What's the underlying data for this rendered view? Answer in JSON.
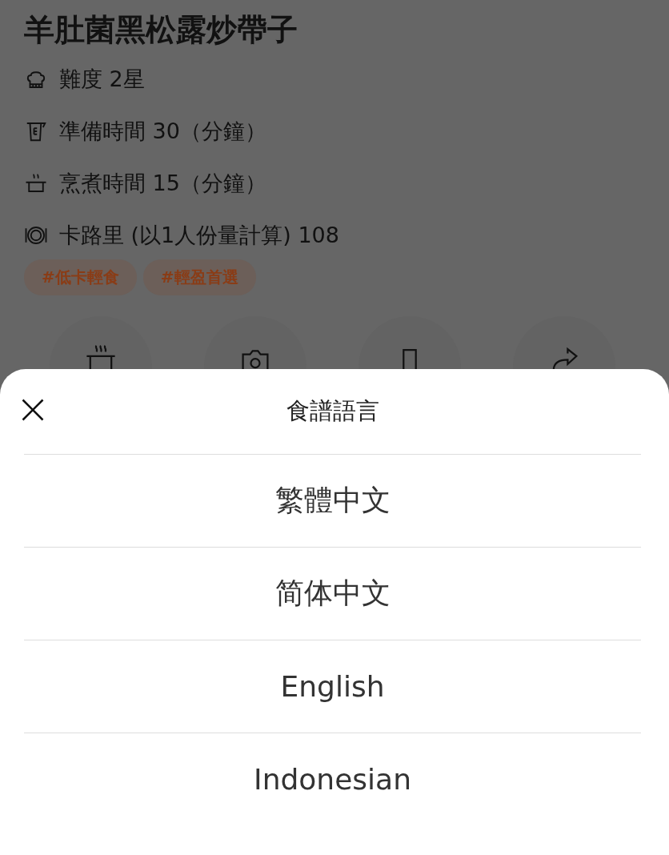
{
  "recipe": {
    "title": "羊肚菌黑松露炒帶子",
    "meta": [
      {
        "kind": "difficulty",
        "text": "難度 2星"
      },
      {
        "kind": "prep",
        "text": "準備時間 30（分鐘）"
      },
      {
        "kind": "cook",
        "text": "烹煮時間 15（分鐘）"
      },
      {
        "kind": "calories",
        "text": "卡路里 (以1人份量計算) 108"
      }
    ],
    "tags": [
      "#低卡輕食",
      "#輕盈首選"
    ],
    "actions": [
      {
        "kind": "cook"
      },
      {
        "kind": "camera"
      },
      {
        "kind": "bookmark"
      },
      {
        "kind": "share"
      }
    ]
  },
  "sheet": {
    "title": "食譜語言",
    "options": [
      "繁體中文",
      "简体中文",
      "English",
      "Indonesian"
    ]
  }
}
